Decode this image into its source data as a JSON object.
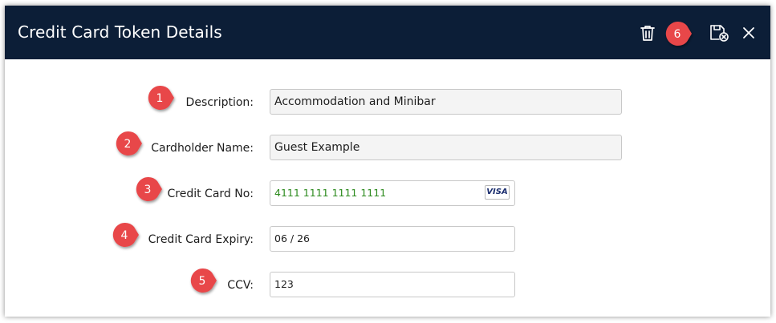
{
  "dialog": {
    "title": "Credit Card Token Details",
    "icons": {
      "delete": "trash-icon",
      "save": "save-icon",
      "close": "close-icon"
    }
  },
  "form": {
    "description": {
      "label": "Description:",
      "value": "Accommodation and Minibar"
    },
    "cardholder": {
      "label": "Cardholder Name:",
      "value": "Guest Example"
    },
    "card_number": {
      "label": "Credit Card No:",
      "value": "4111 1111 1111 1111",
      "brand": "VISA"
    },
    "expiry": {
      "label": "Credit Card Expiry:",
      "value": "06 / 26"
    },
    "ccv": {
      "label": "CCV:",
      "value": "123"
    }
  },
  "callouts": [
    "1",
    "2",
    "3",
    "4",
    "5",
    "6"
  ],
  "colors": {
    "header_bg": "#0c1e37",
    "callout_red": "#e8464a",
    "card_number_text": "#2e8b1f"
  }
}
